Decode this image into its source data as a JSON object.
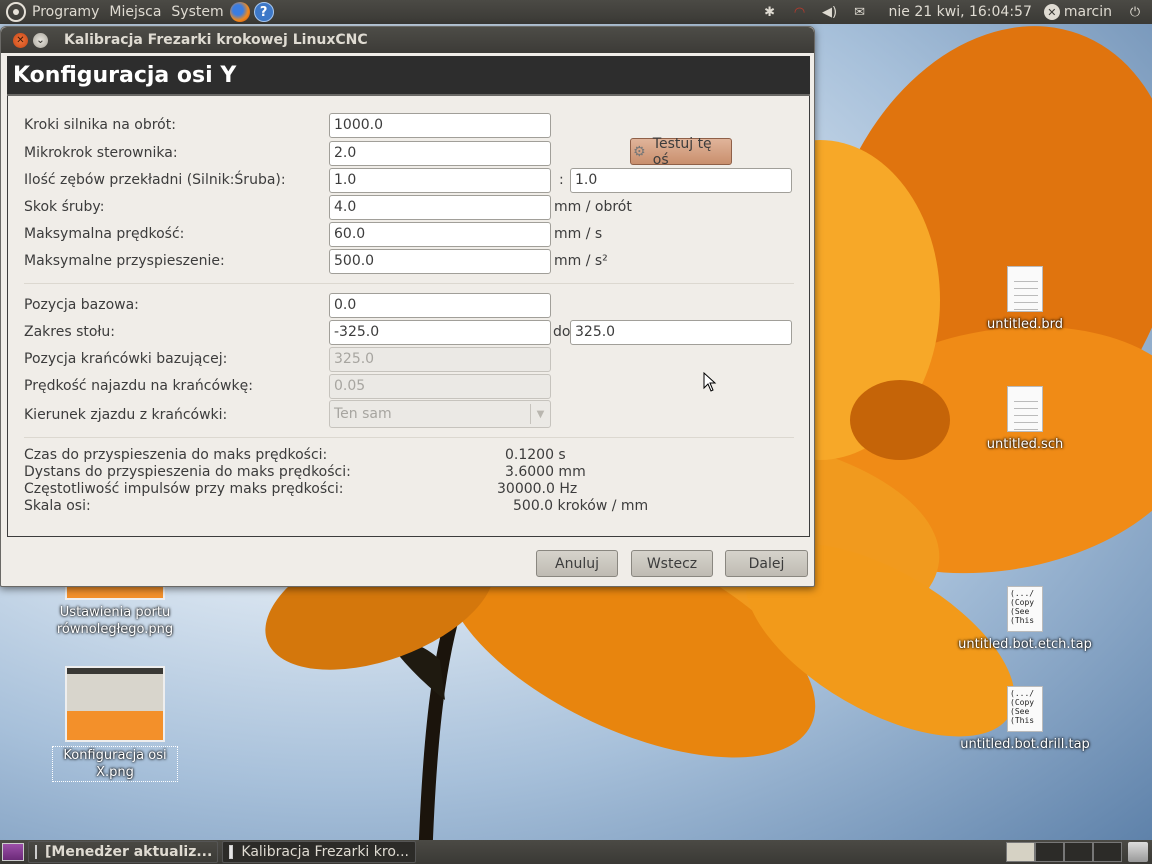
{
  "top_panel": {
    "menu_apps": "Programy",
    "menu_places": "Miejsca",
    "menu_system": "System",
    "help_glyph": "?",
    "clock": "nie 21 kwi, 16:04:57",
    "user": "marcin",
    "icons": [
      "ubuntu-logo-icon",
      "firefox-icon",
      "help-icon",
      "network-icon",
      "wifi-icon",
      "volume-icon",
      "mail-icon",
      "user-status-icon",
      "power-icon"
    ]
  },
  "window": {
    "title": "Kalibracja Frezarki krokowej LinuxCNC",
    "banner": "Konfiguracja osi Y",
    "fields": {
      "steps_label": "Kroki silnika na obrót:",
      "steps_value": "1000.0",
      "microstep_label": "Mikrokrok sterownika:",
      "microstep_value": "2.0",
      "gear_label": "Ilość zębów przekładni (Silnik:Śruba):",
      "gear_motor": "1.0",
      "gear_sep": ":",
      "gear_screw": "1.0",
      "pitch_label": "Skok śruby:",
      "pitch_value": "4.0",
      "pitch_unit": "mm / obrót",
      "maxvel_label": "Maksymalna prędkość:",
      "maxvel_value": "60.0",
      "maxvel_unit": "mm / s",
      "maxacc_label": "Maksymalne przyspieszenie:",
      "maxacc_value": "500.0",
      "maxacc_unit": "mm / s²",
      "home_label": "Pozycja bazowa:",
      "home_value": "0.0",
      "range_label": "Zakres stołu:",
      "range_min": "-325.0",
      "range_to": "do",
      "range_max": "325.0",
      "homesw_label": "Pozycja krańcówki bazującej:",
      "homesw_value": "325.0",
      "searchvel_label": "Prędkość najazdu na krańcówkę:",
      "searchvel_value": "0.05",
      "latchdir_label": "Kierunek zjazdu z krańcówki:",
      "latchdir_value": "Ten sam"
    },
    "test_button": "Testuj tę oś",
    "info": [
      {
        "label": "Czas do przyspieszenia do maks prędkości:",
        "value": "0.1200 s"
      },
      {
        "label": "Dystans do przyspieszenia do maks prędkości:",
        "value": "3.6000 mm"
      },
      {
        "label": "Częstotliwość impulsów przy maks prędkości:",
        "value": "30000.0 Hz"
      },
      {
        "label": "Skala osi:",
        "value": "500.0 kroków / mm"
      }
    ],
    "buttons": {
      "cancel": "Anuluj",
      "back": "Wstecz",
      "next": "Dalej"
    }
  },
  "desktop": {
    "icons": [
      {
        "label": "untitled.brd"
      },
      {
        "label": "untitled.sch"
      },
      {
        "label": "untitled.bot.etch.tap",
        "preview": "(.../\n(Copy\n(See\n(This"
      },
      {
        "label": "untitled.bot.drill.tap",
        "preview": "(.../\n(Copy\n(See\n(This"
      },
      {
        "label": "Ustawienia portu równoległego.png"
      },
      {
        "label": "Konfiguracja osi X.png"
      }
    ]
  },
  "taskbar": {
    "items": [
      {
        "label": "[Menedżer aktualiz..."
      },
      {
        "label": "Kalibracja Frezarki kro..."
      }
    ]
  }
}
